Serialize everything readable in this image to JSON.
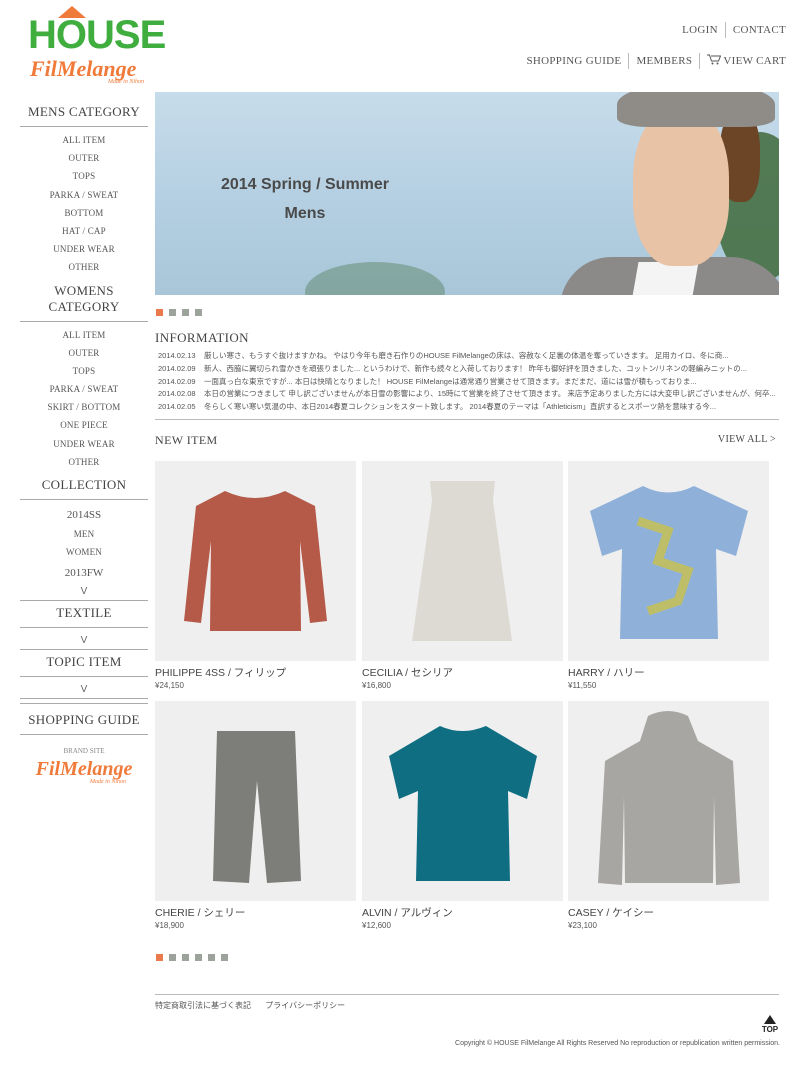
{
  "brand": {
    "logo_top": "HOUSE",
    "logo_bottom": "FilMelange",
    "logo_tagline": "Made in Nihon"
  },
  "top_nav": {
    "login": "LOGIN",
    "contact": "CONTACT"
  },
  "sub_nav": {
    "shopping_guide": "SHOPPING GUIDE",
    "members": "MEMBERS",
    "view_cart": "VIEW CART"
  },
  "sidebar": {
    "mens": {
      "heading": "MENS CATEGORY",
      "items": [
        "ALL ITEM",
        "OUTER",
        "TOPS",
        "PARKA / SWEAT",
        "BOTTOM",
        "HAT / CAP",
        "UNDER WEAR",
        "OTHER"
      ]
    },
    "womens": {
      "heading": "WOMENS CATEGORY",
      "items": [
        "ALL ITEM",
        "OUTER",
        "TOPS",
        "PARKA / SWEAT",
        "SKIRT / BOTTOM",
        "ONE PIECE",
        "UNDER WEAR",
        "OTHER"
      ]
    },
    "collection": {
      "heading": "COLLECTION",
      "season1": "2014SS",
      "men": "MEN",
      "women": "WOMEN",
      "season2": "2013FW",
      "chevron": "V"
    },
    "textile": {
      "heading": "TEXTILE",
      "chevron": "V"
    },
    "topic": {
      "heading": "TOPIC ITEM",
      "chevron": "V"
    },
    "guide": {
      "heading": "SHOPPING GUIDE"
    },
    "brand_site": {
      "label": "BRAND SITE",
      "logo": "FilMelange",
      "tagline": "Made in Nihon"
    }
  },
  "hero": {
    "line1": "2014  Spring / Summer",
    "line2": "Mens"
  },
  "information": {
    "heading": "INFORMATION",
    "items": [
      {
        "date": "2014.02.13",
        "text": "厳しい寒さ、もうすぐ抜けますかね。 やはり今年も磨き石作りのHOUSE FilMelangeの床は、容赦なく足裏の体温を奪っていきます。 足用カイロ、冬に商..."
      },
      {
        "date": "2014.02.09",
        "text": "新人、西脇に翼切られ雪かきを頑張りました... というわけで、新作も続々と入荷しております！ 昨年も御好評を頂きました、コットン/リネンの軽編みニットの..."
      },
      {
        "date": "2014.02.09",
        "text": "一面真っ白な東京ですが... 本日は快晴となりました！ HOUSE FilMelangeは通常通り営業させて頂きます。まだまだ、道には雪が積もっておりま..."
      },
      {
        "date": "2014.02.08",
        "text": "本日の営業につきまして 申し訳ございませんが本日雪の影響により、15時にて営業を終了させて頂きます。 来店予定ありました方には大変申し訳ございませんが、何卒..."
      },
      {
        "date": "2014.02.05",
        "text": "冬らしく寒い寒い気温の中、本日2014春夏コレクションをスタート致します。 2014春夏のテーマは「Athleticism」直訳するとスポーツ熱を意味する今..."
      }
    ]
  },
  "new_item": {
    "heading": "NEW ITEM",
    "view_all": "VIEW ALL >",
    "products": [
      {
        "name": "PHILIPPE 4SS / フィリップ",
        "price": "¥24,150",
        "color": "#b55a48"
      },
      {
        "name": "CECILIA / セシリア",
        "price": "¥16,800",
        "color": "#dddad4"
      },
      {
        "name": "HARRY / ハリー",
        "price": "¥11,550",
        "color": "#8fb1d9"
      },
      {
        "name": "CHERIE / シェリー",
        "price": "¥18,900",
        "color": "#7d7e7a"
      },
      {
        "name": "ALVIN / アルヴィン",
        "price": "¥12,600",
        "color": "#0f6e82"
      },
      {
        "name": "CASEY / ケイシー",
        "price": "¥23,100",
        "color": "#a8a6a2"
      }
    ]
  },
  "footer": {
    "link1": "特定商取引法に基づく表記",
    "link2": "プライバシーポリシー",
    "top": "TOP",
    "copyright": "Copyright © HOUSE FilMelange All Rights Reserved No reproduction or republication written permission."
  },
  "colors": {
    "accent": "#ea7a4c",
    "logo_green": "#3fae3f",
    "logo_orange": "#f07a3a",
    "dot_inactive": "#9ba39a"
  }
}
